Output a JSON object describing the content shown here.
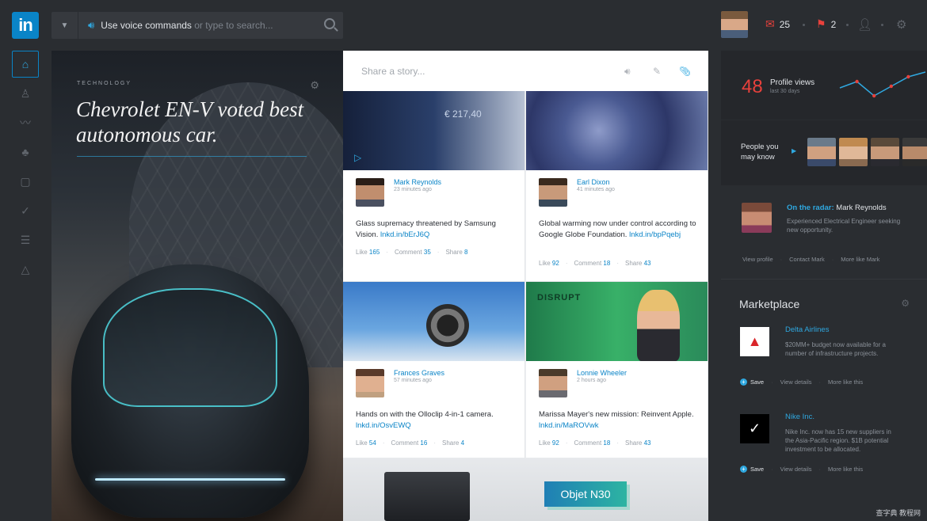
{
  "brand": {
    "logo_text": "in",
    "accent": "#0a84c7",
    "alert": "#e8413c"
  },
  "search": {
    "voice_text": "Use voice commands",
    "rest_text": " or type to search..."
  },
  "header": {
    "messages_count": "25",
    "notifications_count": "2"
  },
  "nav": [
    "home-icon",
    "profile-icon",
    "analytics-icon",
    "network-icon",
    "jobs-icon",
    "check-icon",
    "list-icon",
    "triangle-icon"
  ],
  "hero": {
    "category": "TECHNOLOGY",
    "headline": "Chevrolet EN-V voted best autonomous car."
  },
  "composer": {
    "placeholder": "Share a story..."
  },
  "feed": [
    {
      "img_text": "€ 217,40",
      "name": "Mark Reynolds",
      "time": "23 minutes ago",
      "text": "Glass supremacy threatened by Samsung Vision. ",
      "link": "lnkd.in/bErJ6Q",
      "like_label": "Like",
      "likes": "165",
      "comment_label": "Comment",
      "comments": "35",
      "share_label": "Share",
      "shares": "8"
    },
    {
      "name": "Earl Dixon",
      "time": "41 minutes ago",
      "text": "Global warming now under control according to Google Globe Foundation. ",
      "link": "lnkd.in/bpPqebj",
      "like_label": "Like",
      "likes": "92",
      "comment_label": "Comment",
      "comments": "18",
      "share_label": "Share",
      "shares": "43"
    },
    {
      "name": "Frances Graves",
      "time": "57 minutes ago",
      "text": "Hands on with the Olloclip 4-in-1 camera. ",
      "link": "lnkd.in/OsvEWQ",
      "like_label": "Like",
      "likes": "54",
      "comment_label": "Comment",
      "comments": "16",
      "share_label": "Share",
      "shares": "4"
    },
    {
      "img_text": "DISRUPT",
      "name": "Lonnie Wheeler",
      "time": "2 hours ago",
      "text": "Marissa Mayer's new mission: Reinvent Apple. ",
      "link": "lnkd.in/MaROVwk",
      "like_label": "Like",
      "likes": "92",
      "comment_label": "Comment",
      "comments": "18",
      "share_label": "Share",
      "shares": "43"
    }
  ],
  "promo": {
    "label": "Objet N30"
  },
  "profile_views": {
    "count": "48",
    "label": "Profile views",
    "sub": "last 30 days",
    "trend": [
      0.55,
      0.35,
      0.8,
      0.5,
      0.2,
      0.05
    ]
  },
  "people": {
    "label": "People you may know"
  },
  "radar": {
    "prefix": "On the radar:",
    "name": " Mark Reynolds",
    "desc": "Experienced Electrical Engineer seeking new opportunity.",
    "actions": [
      "View profile",
      "Contact Mark",
      "More like Mark"
    ]
  },
  "marketplace": {
    "title": "Marketplace",
    "items": [
      {
        "logo": "delta-logo",
        "name": "Delta Airlines",
        "desc": "$20MM+ budget now available for a number of infrastructure projects.",
        "save": "Save",
        "details": "View details",
        "more": "More like this"
      },
      {
        "logo": "nike-logo",
        "name": "Nike Inc.",
        "desc": "Nike Inc. now has 15 new suppliers in the Asia-Pacific region. $1B potential investment to be allocated.",
        "save": "Save",
        "details": "View details",
        "more": "More like this"
      }
    ]
  },
  "watermark": "查字典 教程网"
}
